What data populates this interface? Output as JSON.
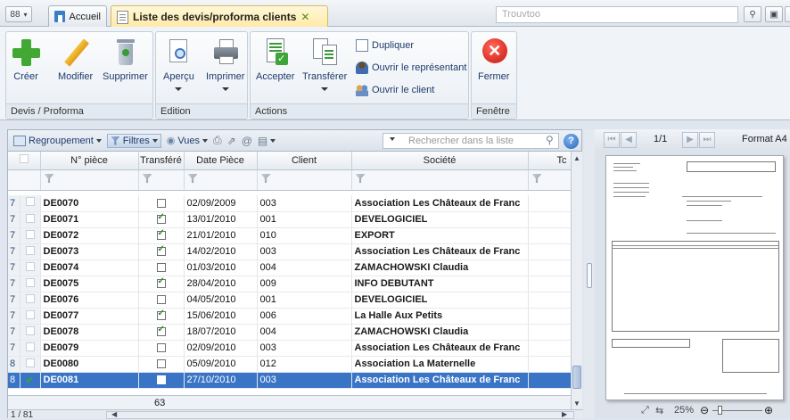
{
  "tabbar": {
    "menu_glyph": "88",
    "accueil_label": "Accueil",
    "liste_label": "Liste des devis/proforma clients",
    "search_placeholder": "Trouvtoo"
  },
  "ribbon": {
    "groups": {
      "devis": "Devis / Proforma",
      "edition": "Edition",
      "actions": "Actions",
      "fenetre": "Fenêtre"
    },
    "creer": "Créer",
    "modifier": "Modifier",
    "supprimer": "Supprimer",
    "apercu": "Aperçu",
    "imprimer": "Imprimer",
    "accepter": "Accepter",
    "transferer": "Transférer",
    "dupliquer": "Dupliquer",
    "ouvrir_representant": "Ouvrir le représentant",
    "ouvrir_client": "Ouvrir le client",
    "fermer": "Fermer"
  },
  "list_toolbar": {
    "regroupement": "Regroupement",
    "filtres": "Filtres",
    "vues": "Vues",
    "search_placeholder": "Rechercher dans la liste",
    "help": "?"
  },
  "columns": [
    "N° pièce",
    "Transféré",
    "Date Pièce",
    "Client",
    "Société",
    "Tc"
  ],
  "rows": [
    {
      "ind": "7",
      "ref": "DE0070",
      "transfere": false,
      "date": "02/09/2009",
      "client": "003",
      "societe": "Association Les Châteaux de Franc"
    },
    {
      "ind": "7",
      "ref": "DE0071",
      "transfere": true,
      "date": "13/01/2010",
      "client": "001",
      "societe": "DEVELOGICIEL"
    },
    {
      "ind": "7",
      "ref": "DE0072",
      "transfere": true,
      "date": "21/01/2010",
      "client": "010",
      "societe": "EXPORT"
    },
    {
      "ind": "7",
      "ref": "DE0073",
      "transfere": true,
      "date": "14/02/2010",
      "client": "003",
      "societe": "Association Les Châteaux de Franc"
    },
    {
      "ind": "7",
      "ref": "DE0074",
      "transfere": false,
      "date": "01/03/2010",
      "client": "004",
      "societe": "ZAMACHOWSKI Claudia"
    },
    {
      "ind": "7",
      "ref": "DE0075",
      "transfere": true,
      "date": "28/04/2010",
      "client": "009",
      "societe": "INFO DEBUTANT"
    },
    {
      "ind": "7",
      "ref": "DE0076",
      "transfere": false,
      "date": "04/05/2010",
      "client": "001",
      "societe": "DEVELOGICIEL"
    },
    {
      "ind": "7",
      "ref": "DE0077",
      "transfere": true,
      "date": "15/06/2010",
      "client": "006",
      "societe": "La Halle Aux Petits"
    },
    {
      "ind": "7",
      "ref": "DE0078",
      "transfere": true,
      "date": "18/07/2010",
      "client": "004",
      "societe": "ZAMACHOWSKI Claudia"
    },
    {
      "ind": "7",
      "ref": "DE0079",
      "transfere": false,
      "date": "02/09/2010",
      "client": "003",
      "societe": "Association Les Châteaux de Franc"
    },
    {
      "ind": "8",
      "ref": "DE0080",
      "transfere": false,
      "date": "05/09/2010",
      "client": "012",
      "societe": "Association La Maternelle"
    },
    {
      "ind": "8",
      "ref": "DE0081",
      "transfere": false,
      "date": "27/10/2010",
      "client": "003",
      "societe": "Association Les Châteaux de Franc",
      "selected": true
    }
  ],
  "total_count": "63",
  "status": "1 / 81",
  "preview": {
    "page": "1/1",
    "format": "Format A4",
    "zoom": "25%"
  },
  "colors": {
    "selection": "#3a74c6",
    "tab_active": "#ffe9a6",
    "accent": "#1e3a6a"
  }
}
